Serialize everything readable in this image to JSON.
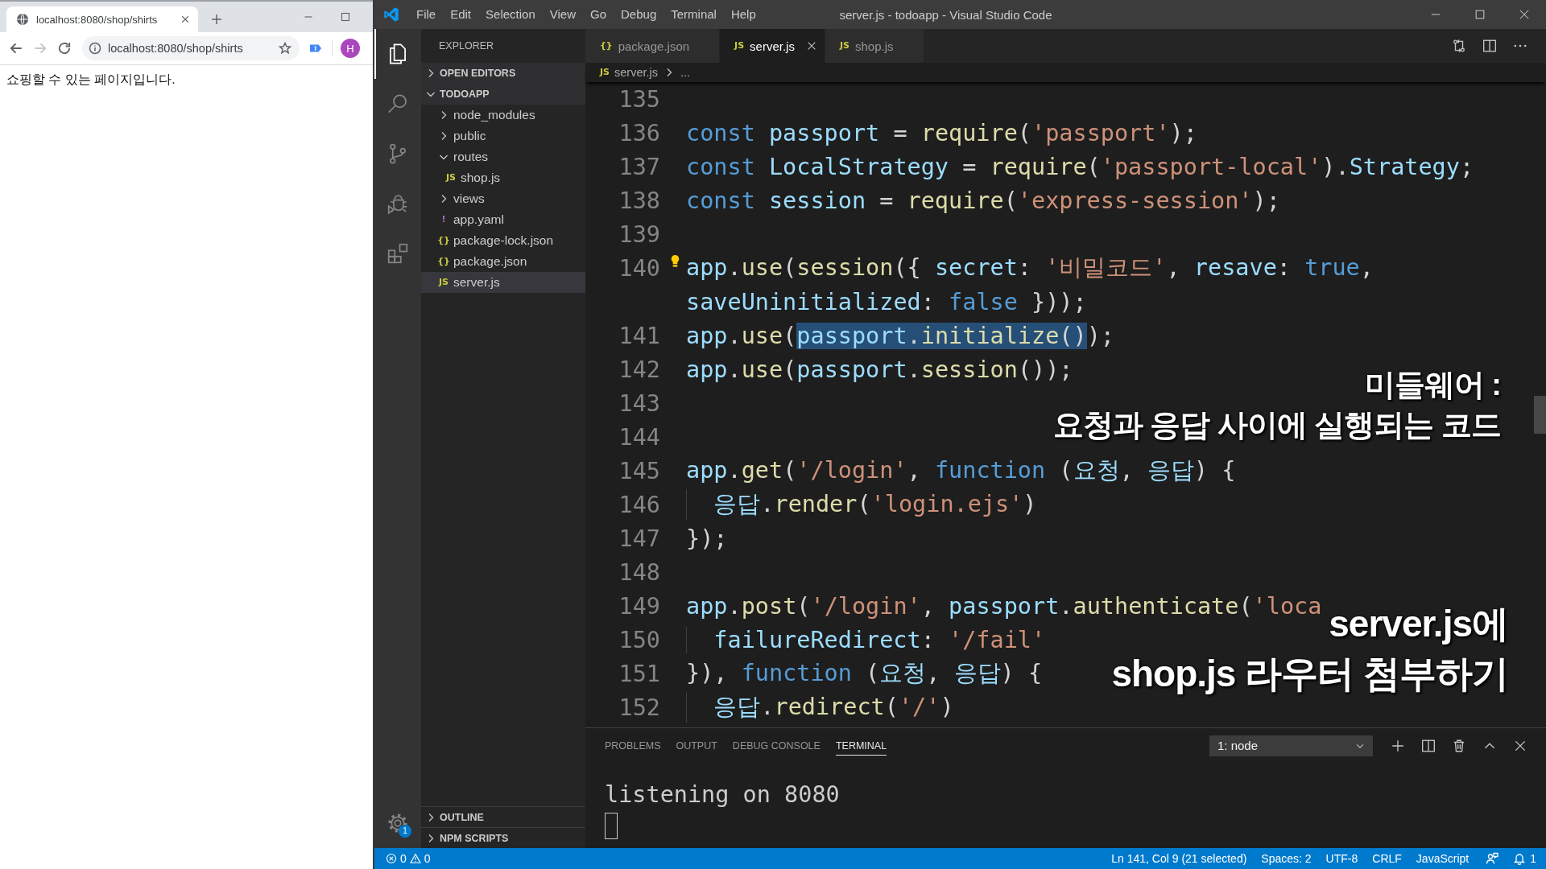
{
  "browser": {
    "tab": {
      "title": "localhost:8080/shop/shirts"
    },
    "nav": [
      {
        "kind": "back",
        "disabled": false
      },
      {
        "kind": "forward",
        "disabled": true
      },
      {
        "kind": "reload",
        "disabled": false
      }
    ],
    "address": {
      "url": "localhost:8080/shop/shirts"
    },
    "profile": {
      "initial": "H"
    },
    "page": {
      "text": "쇼핑할 수 있는 페이지입니다."
    }
  },
  "vscode": {
    "window": {
      "title": "server.js - todoapp - Visual Studio Code"
    },
    "menu": [
      "File",
      "Edit",
      "Selection",
      "View",
      "Go",
      "Debug",
      "Terminal",
      "Help"
    ],
    "activity_bar": {
      "items": [
        {
          "kind": "explorer",
          "selected": true
        },
        {
          "kind": "search",
          "selected": false
        },
        {
          "kind": "source_control",
          "selected": false
        },
        {
          "kind": "debug",
          "selected": false
        },
        {
          "kind": "extensions",
          "selected": false
        }
      ],
      "settings_badge": "1"
    },
    "sidebar": {
      "title": "EXPLORER",
      "sections": [
        {
          "label": "OPEN EDITORS",
          "expanded": false
        },
        {
          "label": "TODOAPP",
          "expanded": true,
          "items": [
            {
              "label": "node_modules",
              "kind": "folder",
              "expanded": false,
              "selected": false
            },
            {
              "label": "public",
              "kind": "folder",
              "expanded": false,
              "selected": false
            },
            {
              "label": "routes",
              "kind": "folder",
              "expanded": true,
              "selected": false,
              "children": [
                {
                  "label": "shop.js",
                  "kind": "file",
                  "icon": "JS",
                  "color": "#cbcb41",
                  "selected": false
                }
              ]
            },
            {
              "label": "views",
              "kind": "folder",
              "expanded": false,
              "selected": false
            },
            {
              "label": "app.yaml",
              "kind": "file",
              "icon": "!",
              "color": "#a074c4",
              "selected": false
            },
            {
              "label": "package-lock.json",
              "kind": "file",
              "icon": "{}",
              "color": "#cbcb41",
              "selected": false
            },
            {
              "label": "package.json",
              "kind": "file",
              "icon": "{}",
              "color": "#cbcb41",
              "selected": false
            },
            {
              "label": "server.js",
              "kind": "file",
              "icon": "JS",
              "color": "#cbcb41",
              "selected": true
            }
          ]
        }
      ],
      "footer_sections": [
        {
          "label": "OUTLINE",
          "expanded": false
        },
        {
          "label": "NPM SCRIPTS",
          "expanded": false
        }
      ]
    },
    "tabs": [
      {
        "label": "package.json",
        "icon": "{}",
        "selected": false
      },
      {
        "label": "server.js",
        "icon": "JS",
        "selected": true
      },
      {
        "label": "shop.js",
        "icon": "JS",
        "selected": false
      }
    ],
    "breadcrumb": {
      "icon": "JS",
      "file": "server.js",
      "more": "..."
    },
    "editor": {
      "lines": [
        {
          "number": "135"
        },
        {
          "number": "136",
          "indented": false,
          "tokens": [
            {
              "text": "const ",
              "kind": "keyword"
            },
            {
              "text": "passport",
              "kind": "variable"
            },
            {
              "text": " = ",
              "kind": "plain"
            },
            {
              "text": "require",
              "kind": "function"
            },
            {
              "text": "(",
              "kind": "plain"
            },
            {
              "text": "'passport'",
              "kind": "string"
            },
            {
              "text": ");",
              "kind": "plain"
            }
          ]
        },
        {
          "number": "137",
          "indented": false,
          "tokens": [
            {
              "text": "const ",
              "kind": "keyword"
            },
            {
              "text": "LocalStrategy",
              "kind": "variable"
            },
            {
              "text": " = ",
              "kind": "plain"
            },
            {
              "text": "require",
              "kind": "function"
            },
            {
              "text": "(",
              "kind": "plain"
            },
            {
              "text": "'passport-local'",
              "kind": "string"
            },
            {
              "text": ").",
              "kind": "plain"
            },
            {
              "text": "Strategy",
              "kind": "variable"
            },
            {
              "text": ";",
              "kind": "plain"
            }
          ]
        },
        {
          "number": "138",
          "indented": false,
          "tokens": [
            {
              "text": "const ",
              "kind": "keyword"
            },
            {
              "text": "session",
              "kind": "variable"
            },
            {
              "text": " = ",
              "kind": "plain"
            },
            {
              "text": "require",
              "kind": "function"
            },
            {
              "text": "(",
              "kind": "plain"
            },
            {
              "text": "'express-session'",
              "kind": "string"
            },
            {
              "text": ");",
              "kind": "plain"
            }
          ]
        },
        {
          "number": "139"
        },
        {
          "number": "140",
          "indented": false,
          "tokens": [
            {
              "text": "app",
              "kind": "variable"
            },
            {
              "text": ".",
              "kind": "plain"
            },
            {
              "text": "use",
              "kind": "function"
            },
            {
              "text": "(",
              "kind": "plain"
            },
            {
              "text": "session",
              "kind": "function"
            },
            {
              "text": "({ ",
              "kind": "plain"
            },
            {
              "text": "secret",
              "kind": "variable"
            },
            {
              "text": ": ",
              "kind": "plain"
            },
            {
              "text": "'비밀코드'",
              "kind": "string"
            },
            {
              "text": ", ",
              "kind": "plain"
            },
            {
              "text": "resave",
              "kind": "variable"
            },
            {
              "text": ": ",
              "kind": "plain"
            },
            {
              "text": "true",
              "kind": "keyword"
            },
            {
              "text": ",",
              "kind": "plain"
            }
          ],
          "wrapped": [
            {
              "text": "saveUninitialized",
              "kind": "variable"
            },
            {
              "text": ": ",
              "kind": "plain"
            },
            {
              "text": "false",
              "kind": "keyword"
            },
            {
              "text": " }));",
              "kind": "plain"
            }
          ]
        },
        {
          "number": "141",
          "indented": false,
          "tokens": [
            {
              "text": "app",
              "kind": "variable",
              "selected": false
            },
            {
              "text": ".",
              "kind": "plain",
              "selected": false
            },
            {
              "text": "use",
              "kind": "function",
              "selected": false
            },
            {
              "text": "(",
              "kind": "plain",
              "selected": false
            },
            {
              "text": "passport",
              "kind": "variable",
              "selected": true
            },
            {
              "text": ".",
              "kind": "plain",
              "selected": true
            },
            {
              "text": "initialize",
              "kind": "function",
              "selected": true
            },
            {
              "text": "()",
              "kind": "plain",
              "selected": true
            },
            {
              "text": ");",
              "kind": "plain",
              "selected": false
            }
          ]
        },
        {
          "number": "142",
          "indented": false,
          "tokens": [
            {
              "text": "app",
              "kind": "variable"
            },
            {
              "text": ".",
              "kind": "plain"
            },
            {
              "text": "use",
              "kind": "function"
            },
            {
              "text": "(",
              "kind": "plain"
            },
            {
              "text": "passport",
              "kind": "variable"
            },
            {
              "text": ".",
              "kind": "plain"
            },
            {
              "text": "session",
              "kind": "function"
            },
            {
              "text": "());",
              "kind": "plain"
            }
          ]
        },
        {
          "number": "143"
        },
        {
          "number": "144"
        },
        {
          "number": "145",
          "indented": false,
          "tokens": [
            {
              "text": "app",
              "kind": "variable"
            },
            {
              "text": ".",
              "kind": "plain"
            },
            {
              "text": "get",
              "kind": "function"
            },
            {
              "text": "(",
              "kind": "plain"
            },
            {
              "text": "'/login'",
              "kind": "string"
            },
            {
              "text": ", ",
              "kind": "plain"
            },
            {
              "text": "function",
              "kind": "keyword"
            },
            {
              "text": " (",
              "kind": "plain"
            },
            {
              "text": "요청",
              "kind": "variable"
            },
            {
              "text": ", ",
              "kind": "plain"
            },
            {
              "text": "응답",
              "kind": "variable"
            },
            {
              "text": ") {",
              "kind": "plain"
            }
          ]
        },
        {
          "number": "146",
          "indented": true,
          "tokens": [
            {
              "text": "응답",
              "kind": "variable"
            },
            {
              "text": ".",
              "kind": "plain"
            },
            {
              "text": "render",
              "kind": "function"
            },
            {
              "text": "(",
              "kind": "plain"
            },
            {
              "text": "'login.ejs'",
              "kind": "string"
            },
            {
              "text": ")",
              "kind": "plain"
            }
          ]
        },
        {
          "number": "147",
          "indented": false,
          "tokens": [
            {
              "text": "});",
              "kind": "plain"
            }
          ]
        },
        {
          "number": "148"
        },
        {
          "number": "149",
          "indented": false,
          "tokens": [
            {
              "text": "app",
              "kind": "variable"
            },
            {
              "text": ".",
              "kind": "plain"
            },
            {
              "text": "post",
              "kind": "function"
            },
            {
              "text": "(",
              "kind": "plain"
            },
            {
              "text": "'/login'",
              "kind": "string"
            },
            {
              "text": ", ",
              "kind": "plain"
            },
            {
              "text": "passport",
              "kind": "variable"
            },
            {
              "text": ".",
              "kind": "plain"
            },
            {
              "text": "authenticate",
              "kind": "function"
            },
            {
              "text": "(",
              "kind": "plain"
            },
            {
              "text": "'loca",
              "kind": "string"
            }
          ]
        },
        {
          "number": "150",
          "indented": true,
          "tokens": [
            {
              "text": "failureRedirect",
              "kind": "variable"
            },
            {
              "text": ": ",
              "kind": "plain"
            },
            {
              "text": "'/fail'",
              "kind": "string"
            }
          ]
        },
        {
          "number": "151",
          "indented": false,
          "tokens": [
            {
              "text": "}), ",
              "kind": "plain"
            },
            {
              "text": "function",
              "kind": "keyword"
            },
            {
              "text": " (",
              "kind": "plain"
            },
            {
              "text": "요청",
              "kind": "variable"
            },
            {
              "text": ", ",
              "kind": "plain"
            },
            {
              "text": "응답",
              "kind": "variable"
            },
            {
              "text": ") {",
              "kind": "plain"
            }
          ]
        },
        {
          "number": "152",
          "indented": true,
          "tokens": [
            {
              "text": "응답",
              "kind": "variable"
            },
            {
              "text": ".",
              "kind": "plain"
            },
            {
              "text": "redirect",
              "kind": "function"
            },
            {
              "text": "(",
              "kind": "plain"
            },
            {
              "text": "'/'",
              "kind": "string"
            },
            {
              "text": ")",
              "kind": "plain"
            }
          ]
        }
      ]
    },
    "captions": [
      {
        "lines": [
          "미들웨어 :",
          "요청과 응답 사이에 실행되는 코드"
        ]
      },
      {
        "lines": [
          "server.js에",
          "shop.js 라우터 첨부하기"
        ]
      }
    ],
    "panel": {
      "tabs": [
        {
          "label": "PROBLEMS",
          "selected": false
        },
        {
          "label": "OUTPUT",
          "selected": false
        },
        {
          "label": "DEBUG CONSOLE",
          "selected": false
        },
        {
          "label": "TERMINAL",
          "selected": true
        }
      ],
      "terminal": "1: node",
      "output": [
        "listening on 8080"
      ]
    },
    "status_bar": {
      "errors": "0",
      "warnings": "0",
      "items": [
        "Ln 141, Col 9 (21 selected)",
        "Spaces: 2",
        "UTF-8",
        "CRLF",
        "JavaScript"
      ],
      "notifications": "1"
    }
  }
}
